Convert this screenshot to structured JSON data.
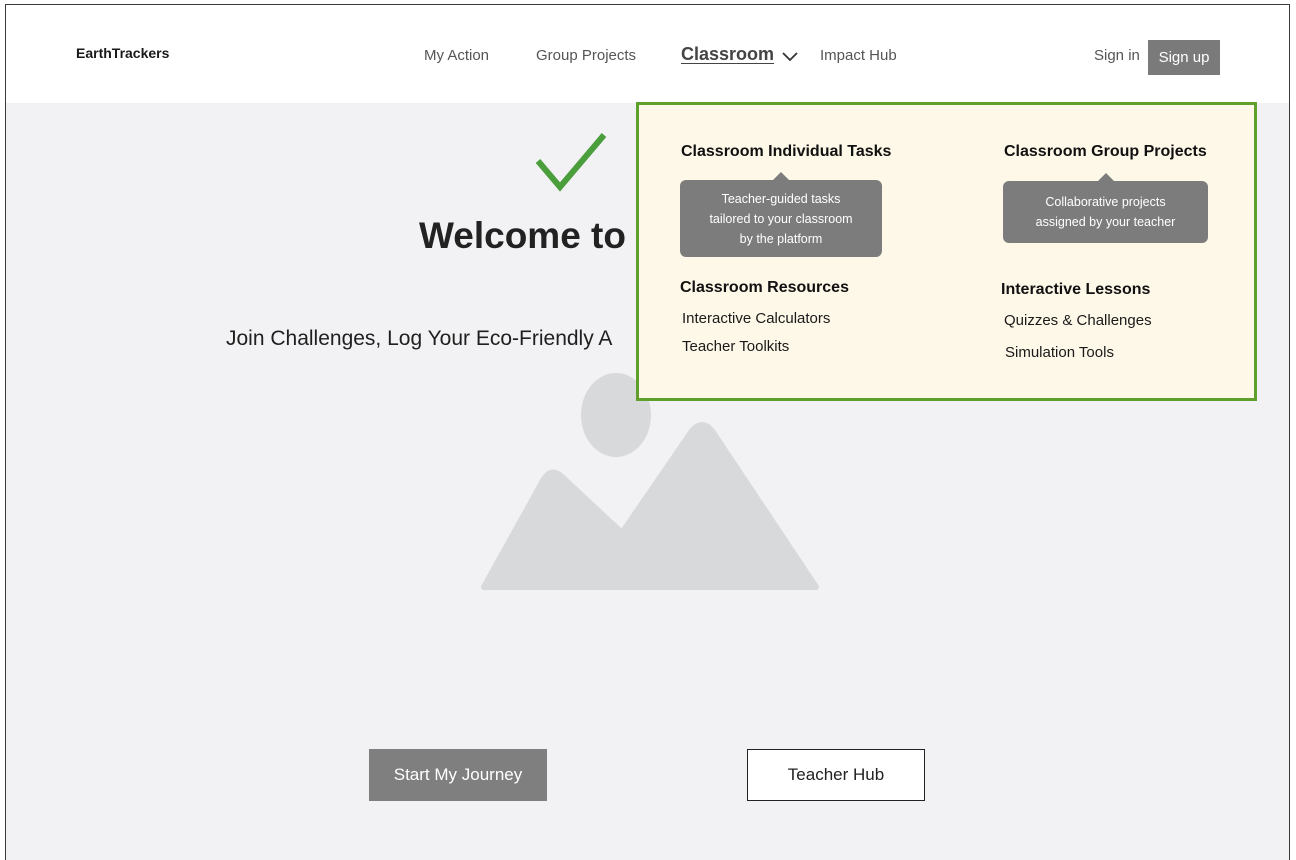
{
  "header": {
    "logo": "EarthTrackers",
    "nav": {
      "my_action": "My Action",
      "group_projects": "Group Projects",
      "classroom": "Classroom",
      "impact_hub": "Impact Hub"
    },
    "sign_in": "Sign in",
    "sign_up": "Sign up"
  },
  "hero": {
    "welcome": "Welcome to",
    "tagline": "Join Challenges, Log Your Eco-Friendly A",
    "start_button": "Start My Journey",
    "teacher_button": "Teacher Hub"
  },
  "dropdown": {
    "individual_tasks": {
      "heading": "Classroom Individual Tasks",
      "tooltip": "Teacher-guided tasks\ntailored to your classroom\nby the platform"
    },
    "group_projects": {
      "heading": "Classroom Group Projects",
      "tooltip": "Collaborative projects\nassigned by your teacher"
    },
    "resources": {
      "heading": "Classroom Resources",
      "items": [
        "Interactive Calculators",
        "Teacher Toolkits"
      ]
    },
    "lessons": {
      "heading": "Interactive Lessons",
      "items": [
        "Quizzes & Challenges",
        "Simulation Tools"
      ]
    }
  },
  "colors": {
    "dropdown_border": "#5ea02b",
    "dropdown_bg": "#fef8e8",
    "check": "#4a9e3c",
    "button_gray": "#7f7f7f"
  }
}
